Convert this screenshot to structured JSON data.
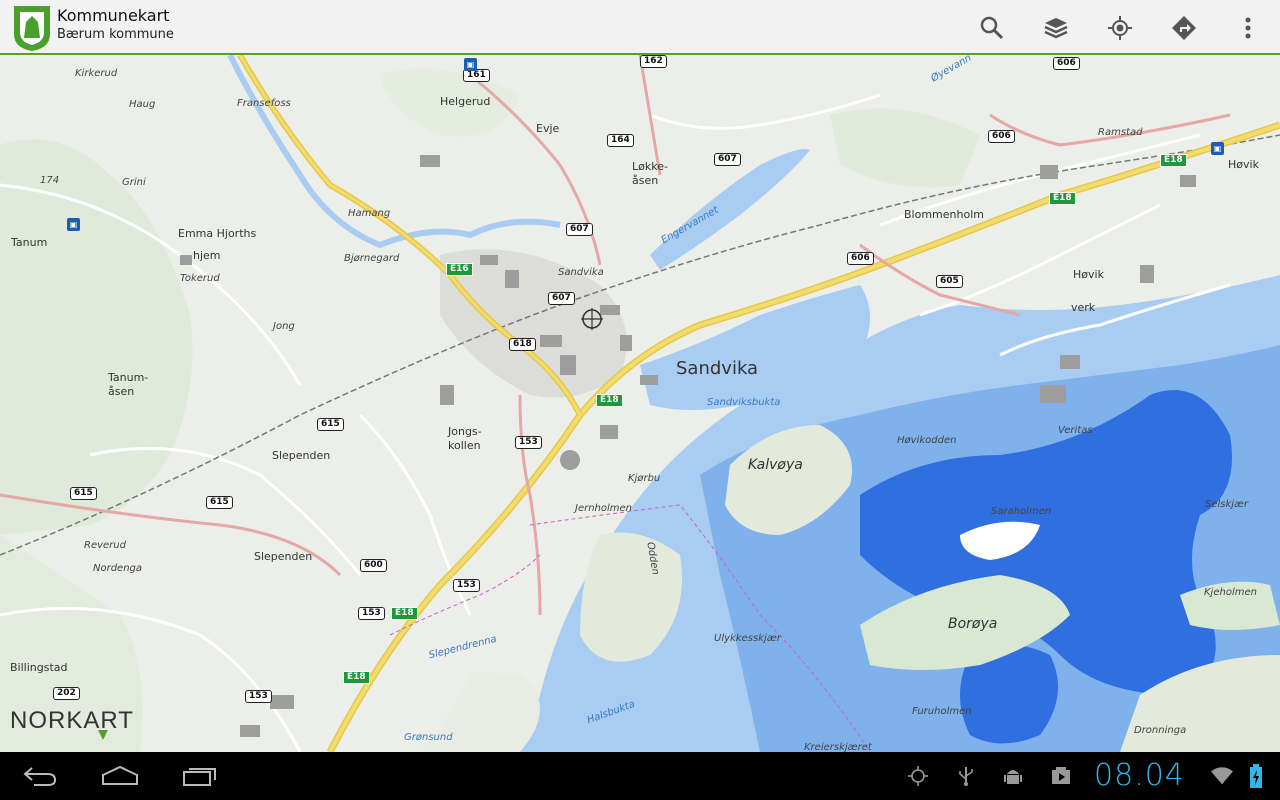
{
  "app": {
    "title": "Kommunekart",
    "subtitle": "Bærum kommune"
  },
  "actions": [
    {
      "name": "search-icon"
    },
    {
      "name": "layers-icon"
    },
    {
      "name": "my-location-icon"
    },
    {
      "name": "directions-icon"
    },
    {
      "name": "overflow-menu-icon"
    }
  ],
  "map": {
    "labels": {
      "sandvika_big": "Sandvika",
      "sandvika": "Sandvika",
      "kalvoya": "Kalvøya",
      "boroya": "Borøya",
      "hovik": "Høvik",
      "hovik2": "Høvik",
      "verk": "verk",
      "blommenholm": "Blommenholm",
      "slependen": "Slependen",
      "slependen2": "Slependen",
      "jongskollen": "Jongs-\nkollen",
      "helgerud": "Helgerud",
      "evje": "Evje",
      "fransefoss": "Fransefoss",
      "emma": "Emma Hjorths",
      "hjem": "hjem",
      "tanum": "Tanum",
      "tanumasen": "Tanum-\nåsen",
      "billingstad": "Billingstad",
      "lokkeasen": "Løkke-\nåsen",
      "jong": "Jong",
      "engervannet": "Engervannet",
      "sandviksbukta": "Sandviksbukta",
      "hovikodden": "Høvikodden",
      "veritas": "Veritas",
      "saraholmen": "Saraholmen",
      "selskjaer": "Selskjær",
      "kjeholmen": "Kjeholmen",
      "jernholmen": "Jernholmen",
      "kjorbu": "Kjørbu",
      "ulykkesskjaer": "Ulykkesskjær",
      "furuholmen": "Furuholmen",
      "dronninga": "Dronninga",
      "slependrenna": "Slependrenna",
      "halsbukta": "Halsbukta",
      "gronsund": "Grønsund",
      "kreierskjaeret": "Kreierskjæret",
      "oddeni": "Odden",
      "reverud": "Reverud",
      "nordenga": "Nordenga",
      "bjornegard": "Bjørnegard",
      "hamang": "Hamang",
      "tokerud": "Tokerud",
      "grini": "Grini",
      "kirkerud": "Kirkerud",
      "haug": "Haug",
      "oyevann": "Øyevann",
      "ramstad": "Ramstad",
      "n174": "174"
    },
    "shields": {
      "r161": "161",
      "r162": "162",
      "r164": "164",
      "r607a": "607",
      "r607b": "607",
      "r607c": "607",
      "r606a": "606",
      "r606b": "606",
      "r606c": "606",
      "r605": "605",
      "r618": "618",
      "r615a": "615",
      "r615b": "615",
      "r615c": "615",
      "r153a": "153",
      "r153b": "153",
      "r153c": "153",
      "r153d": "153",
      "r600": "600",
      "r202": "202"
    },
    "eroutes": {
      "e16": "E16",
      "e18a": "E18",
      "e18b": "E18",
      "e18c": "E18",
      "e18d": "E18",
      "e18e": "E18"
    },
    "attribution": "NORKART"
  },
  "status": {
    "clock": "08.04"
  },
  "colors": {
    "accent_green": "#5a9e2c",
    "water_light": "#a9cdf2",
    "water_deep": "#2f6fe0",
    "clock_blue": "#33b5e5"
  }
}
